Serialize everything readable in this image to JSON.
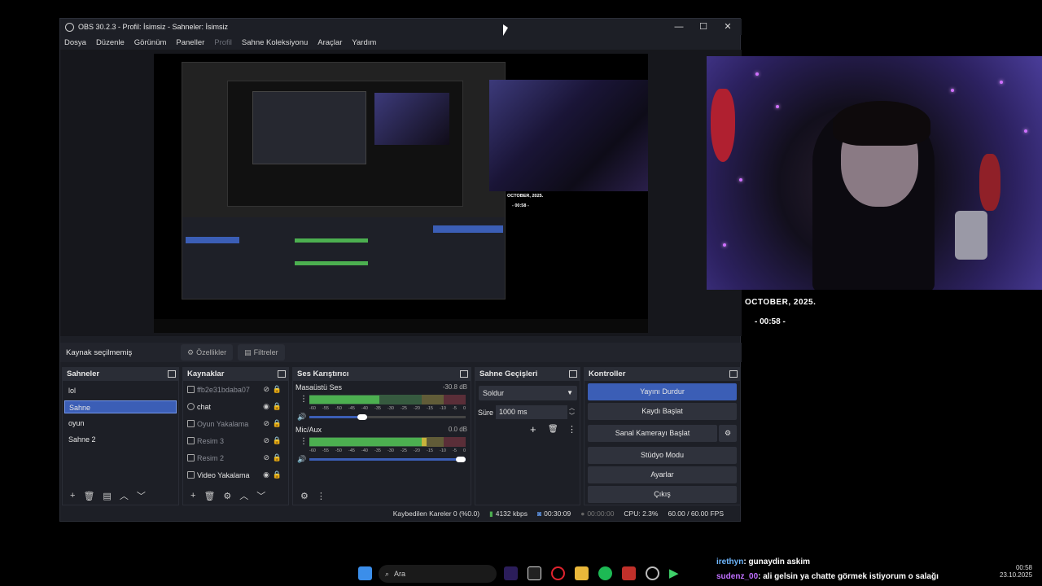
{
  "window": {
    "title": "OBS 30.2.3 - Profil: İsimsiz - Sahneler: İsimsiz",
    "minimize": "—",
    "maximize": "☐",
    "close": "✕"
  },
  "menu": [
    "Dosya",
    "Düzenle",
    "Görünüm",
    "Paneller",
    "Profil",
    "Sahne Koleksiyonu",
    "Araçlar",
    "Yardım"
  ],
  "propbar": {
    "status": "Kaynak seçilmemiş",
    "properties": "Özellikler",
    "filters": "Filtreler"
  },
  "scenes": {
    "title": "Sahneler",
    "items": [
      "lol",
      "Sahne",
      "oyun",
      "Sahne 2"
    ],
    "selected": 1
  },
  "sources": {
    "title": "Kaynaklar",
    "items": [
      {
        "label": "ffb2e31bdaba07",
        "icon": "image-icon"
      },
      {
        "label": "chat",
        "icon": "browser-icon"
      },
      {
        "label": "Oyun Yakalama",
        "icon": "gamepad-icon"
      },
      {
        "label": "Resim 3",
        "icon": "image-icon"
      },
      {
        "label": "Resim 2",
        "icon": "image-icon"
      },
      {
        "label": "Video Yakalama",
        "icon": "camera-icon"
      }
    ]
  },
  "mixer": {
    "title": "Ses Karıştırıcı",
    "channels": [
      {
        "name": "Masaüstü Ses",
        "db": "-30.8 dB",
        "level": 0.45,
        "volume": 0.37
      },
      {
        "name": "Mic/Aux",
        "db": "0.0 dB",
        "level": 0.75,
        "volume": 1.0
      }
    ],
    "ticks": [
      "-60",
      "-55",
      "-50",
      "-45",
      "-40",
      "-35",
      "-30",
      "-25",
      "-20",
      "-15",
      "-10",
      "-5",
      "0"
    ]
  },
  "transitions": {
    "title": "Sahne Geçişleri",
    "type": "Soldur",
    "duration_label": "Süre",
    "duration_value": "1000 ms"
  },
  "controls": {
    "title": "Kontroller",
    "stop_stream": "Yayını Durdur",
    "start_record": "Kaydı Başlat",
    "virtual_cam": "Sanal Kamerayı Başlat",
    "studio_mode": "Stüdyo Modu",
    "settings": "Ayarlar",
    "exit": "Çıkış"
  },
  "status": {
    "dropped": "Kaybedilen Kareler 0 (%0.0)",
    "bitrate": "4132 kbps",
    "stream_time": "00:30:09",
    "rec_time": "00:00:00",
    "cpu": "CPU: 2.3%",
    "fps": "60.00 / 60.00 FPS"
  },
  "overlay": {
    "date": "OCTOBER, 2025.",
    "clock": "- 00:58 -"
  },
  "taskbar": {
    "search": "Ara",
    "chat1_user": "irethyn",
    "chat1_msg": ": gunaydin askim",
    "chat2_user": "sudenz_00",
    "chat2_msg": ": ali gelsin ya chatte görmek istiyorum o salağı",
    "time": "00:58",
    "date": "23.10.2025"
  },
  "colors": {
    "accent": "#3b5eb6",
    "meter_green": "#4caf50",
    "meter_yellow": "#c8b43c",
    "meter_red": "#b4323c"
  }
}
